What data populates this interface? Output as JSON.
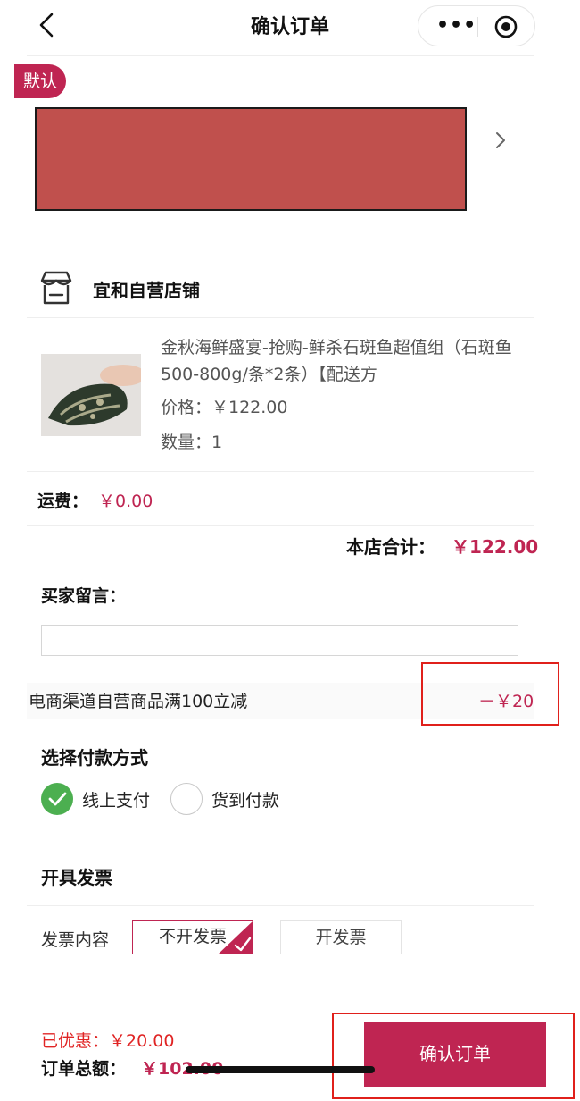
{
  "header": {
    "title": "确认订单",
    "more_icon": "more-dots-icon",
    "close_icon": "target-icon",
    "back_icon": "chevron-left-icon"
  },
  "address": {
    "default_badge": "默认",
    "chevron_icon": "chevron-right-icon"
  },
  "shop": {
    "icon": "store-icon",
    "name": "宜和自营店铺",
    "product": {
      "title": "金秋海鲜盛宴-抢购-鲜杀石斑鱼超值组（石斑鱼500-800g/条*2条）【配送方",
      "price": "价格：￥122.00",
      "quantity": "数量：1"
    },
    "shipping_label": "运费：",
    "shipping_value": "￥0.00",
    "subtotal_label": "本店合计：",
    "subtotal_value": "￥122.00"
  },
  "message": {
    "label": "买家留言：",
    "value": "",
    "placeholder": ""
  },
  "discount": {
    "label": "电商渠道自营商品满100立减",
    "value": "－￥20"
  },
  "payment": {
    "title": "选择付款方式",
    "options": [
      "线上支付",
      "货到付款"
    ],
    "selected": "线上支付"
  },
  "invoice": {
    "title": "开具发票",
    "content_label": "发票内容",
    "options": [
      "不开发票",
      "开发票"
    ],
    "selected": "不开发票"
  },
  "footer": {
    "saved_label": "已优惠：",
    "saved_value": "￥20.00",
    "total_label": "订单总额：",
    "total_value": "￥102.00",
    "confirm_button": "确认订单"
  },
  "colors": {
    "accent": "#bf2552",
    "success": "#4caf50",
    "annotation_box": "#e0201b",
    "redaction": "#c0504d"
  }
}
